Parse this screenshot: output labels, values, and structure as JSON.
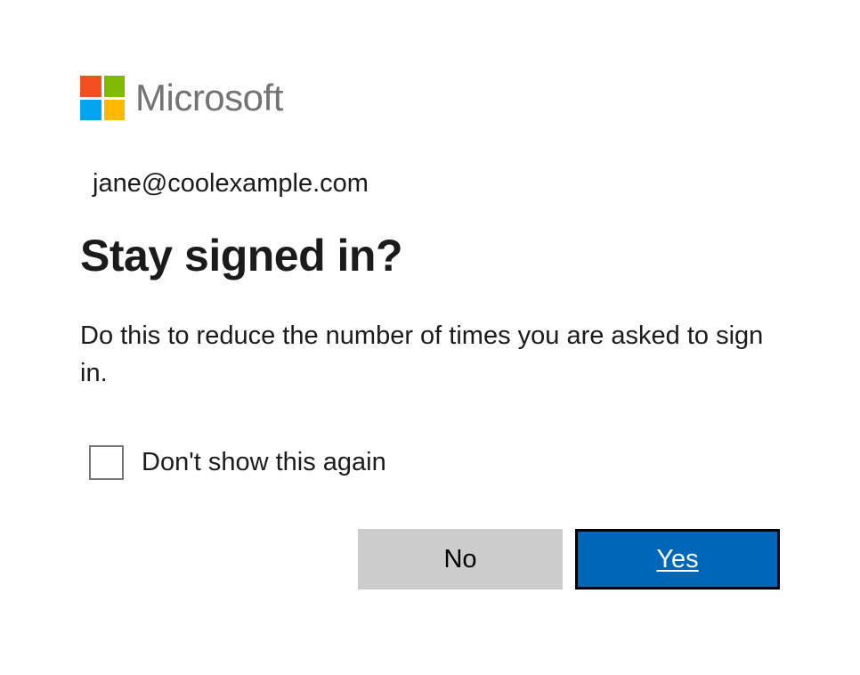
{
  "brand": {
    "name": "Microsoft"
  },
  "account": {
    "email": "jane@coolexample.com"
  },
  "dialog": {
    "title": "Stay signed in?",
    "description": "Do this to reduce the number of times you are asked to sign in.",
    "checkbox_label": "Don't show this again"
  },
  "buttons": {
    "no": "No",
    "yes": "Yes"
  }
}
